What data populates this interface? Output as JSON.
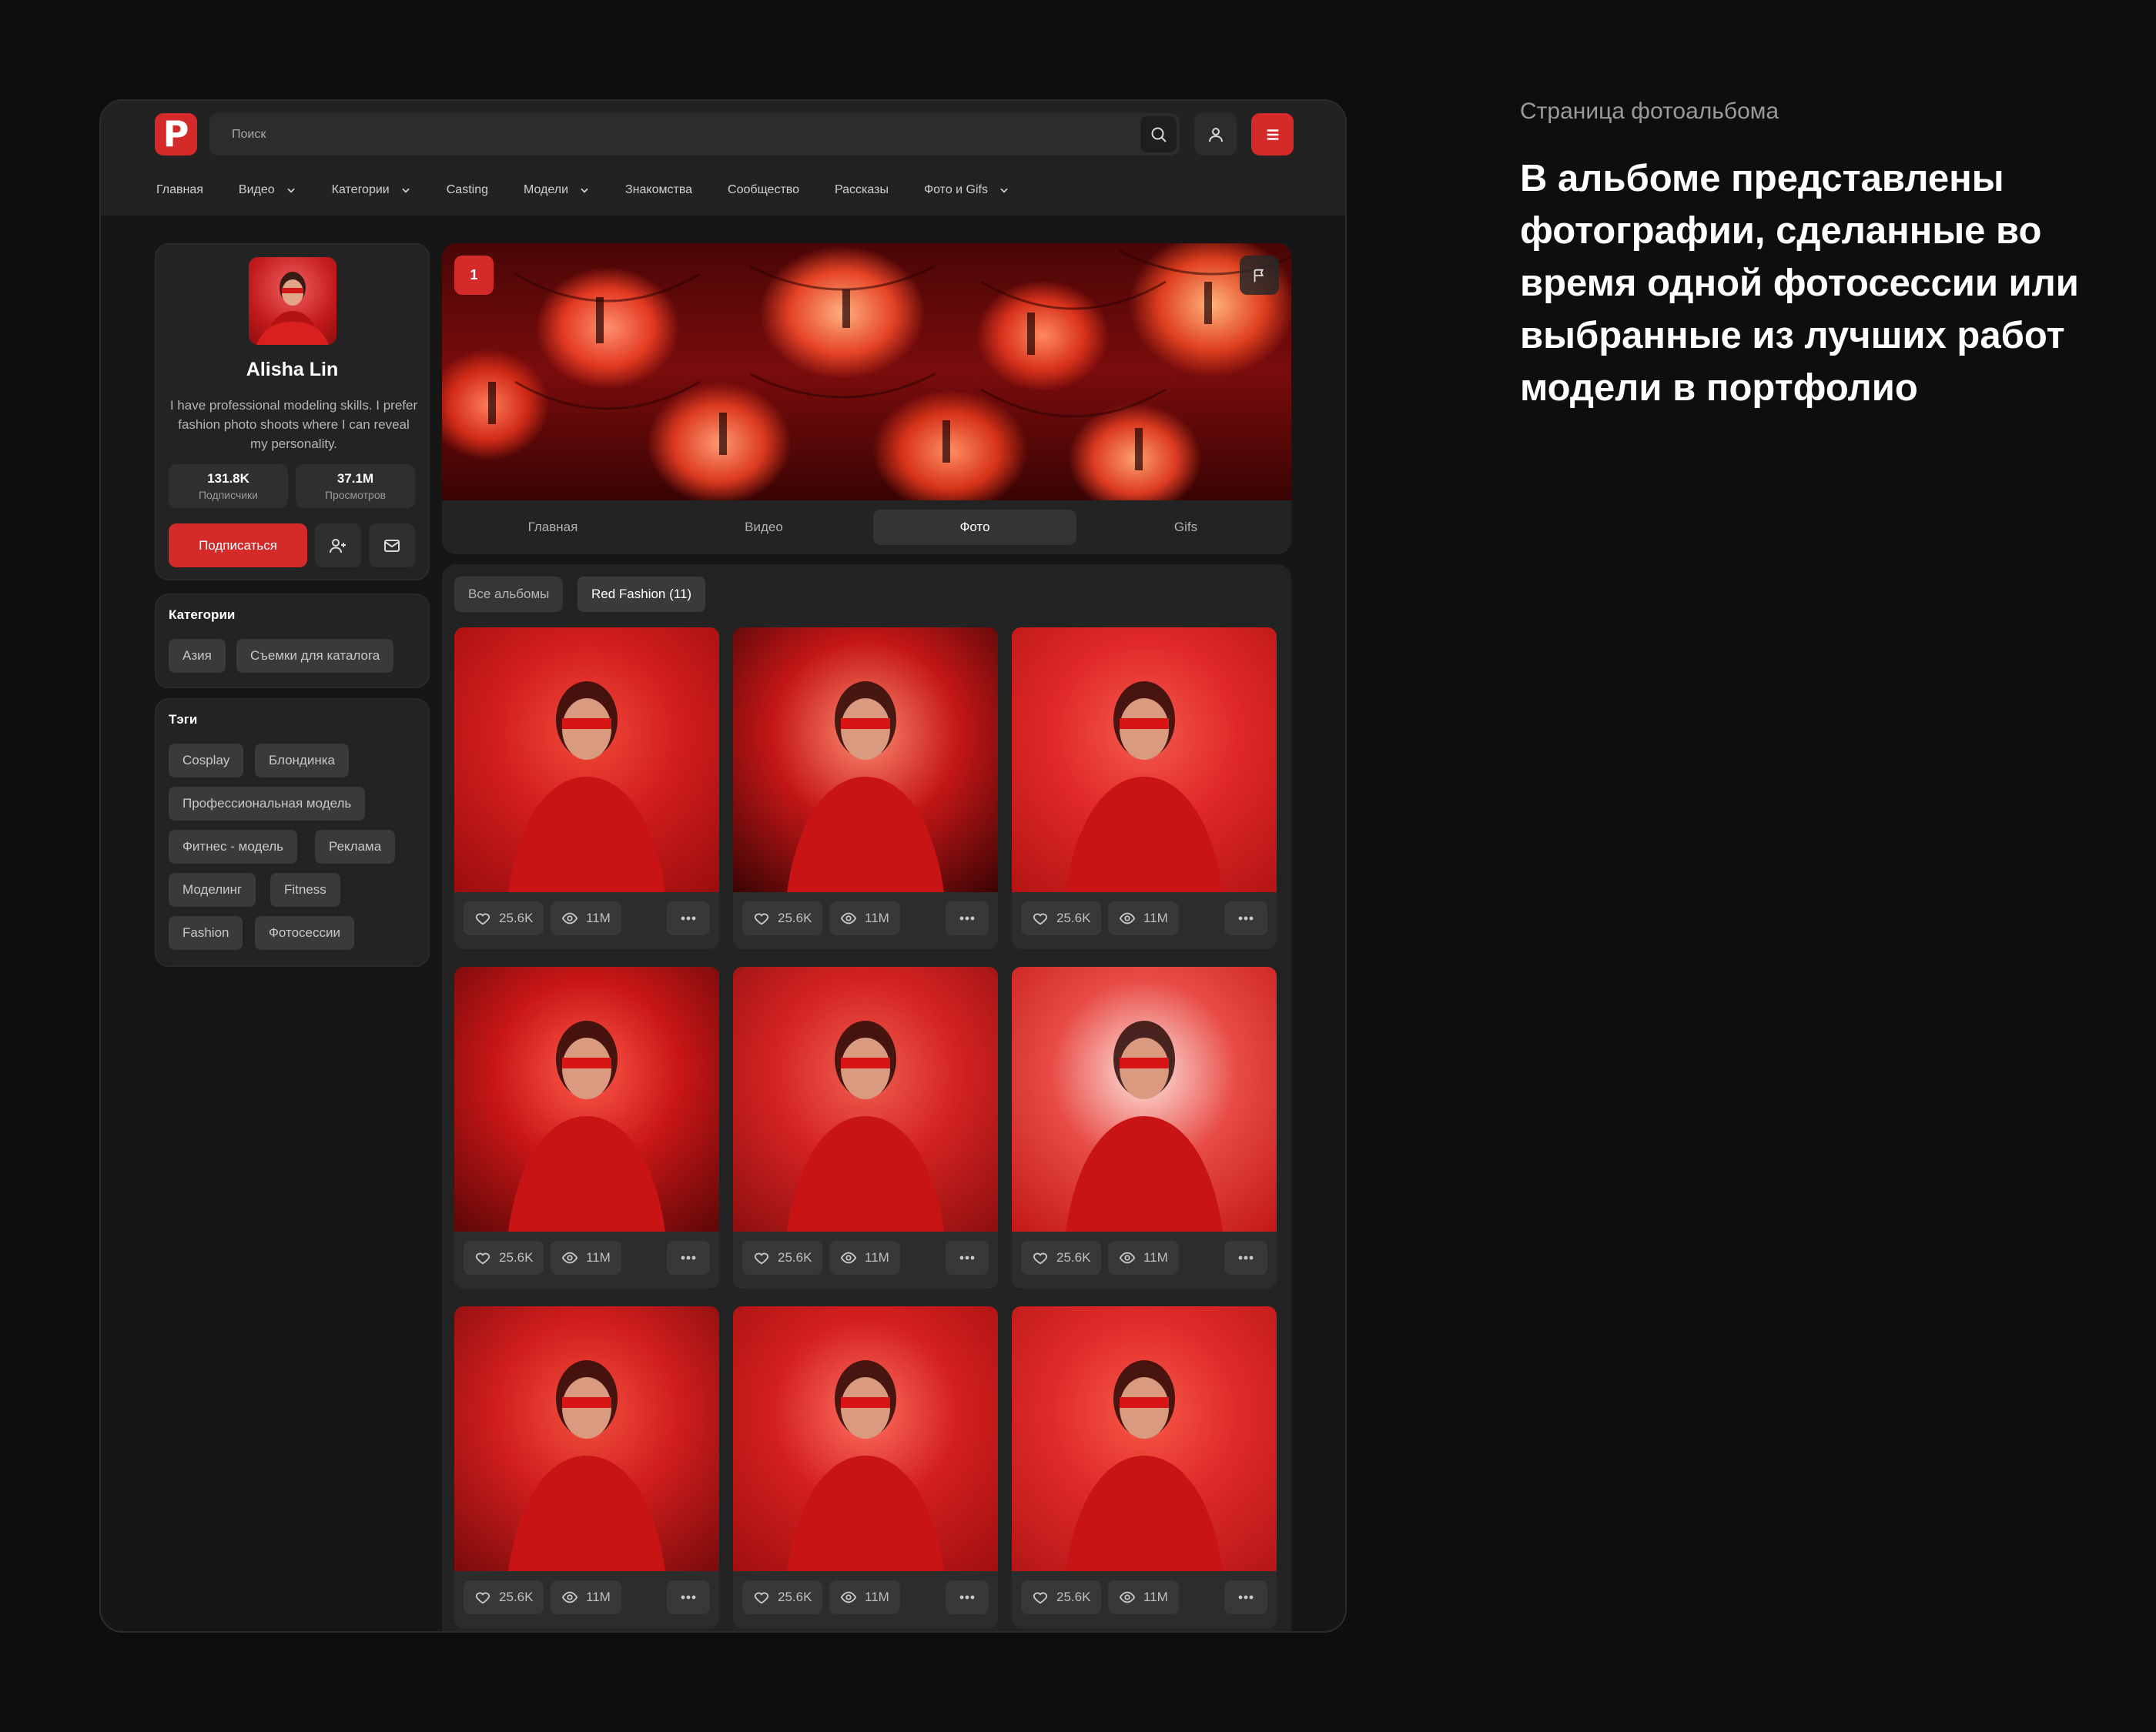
{
  "app": {
    "logo_letter": "P",
    "brand_color": "#d42a2a",
    "search": {
      "placeholder": "Поиск"
    },
    "nav": [
      {
        "label": "Главная",
        "has_dropdown": false
      },
      {
        "label": "Видео",
        "has_dropdown": true
      },
      {
        "label": "Категории",
        "has_dropdown": true
      },
      {
        "label": "Casting",
        "has_dropdown": false
      },
      {
        "label": "Модели",
        "has_dropdown": true
      },
      {
        "label": "Знакомства",
        "has_dropdown": false
      },
      {
        "label": "Сообщество",
        "has_dropdown": false
      },
      {
        "label": "Рассказы",
        "has_dropdown": false
      },
      {
        "label": "Фото и Gifs",
        "has_dropdown": true
      }
    ],
    "icons": [
      "logo-icon",
      "search-icon",
      "user-icon",
      "menu-icon",
      "chevron-down-icon",
      "flag-icon",
      "add-user-icon",
      "mail-icon",
      "heart-icon",
      "eye-icon",
      "more-icon"
    ]
  },
  "profile": {
    "name": "Alisha Lin",
    "bio": "I have professional modeling skills. I prefer fashion photo shoots where I can reveal my personality.",
    "stats": [
      {
        "value": "131.8K",
        "label": "Подписчики"
      },
      {
        "value": "37.1M",
        "label": "Просмотров"
      }
    ],
    "subscribe_label": "Подписаться"
  },
  "categories": {
    "title": "Категории",
    "items": [
      "Азия",
      "Съемки для каталога"
    ]
  },
  "tags": {
    "title": "Тэги",
    "items": [
      "Cosplay",
      "Блондинка",
      "Профессиональная модель",
      "Фитнес - модель",
      "Реклама",
      "Моделинг",
      "Fitness",
      "Fashion",
      "Фотосессии"
    ]
  },
  "hero": {
    "badge": "1",
    "tabs": [
      {
        "label": "Главная",
        "active": false
      },
      {
        "label": "Видео",
        "active": false
      },
      {
        "label": "Фото",
        "active": true
      },
      {
        "label": "Gifs",
        "active": false
      }
    ]
  },
  "albums": {
    "all_label": "Все альбомы",
    "current_label": "Red Fashion (11)"
  },
  "photos": [
    {
      "likes": "25.6K",
      "views": "11M"
    },
    {
      "likes": "25.6K",
      "views": "11M"
    },
    {
      "likes": "25.6K",
      "views": "11M"
    },
    {
      "likes": "25.6K",
      "views": "11M"
    },
    {
      "likes": "25.6K",
      "views": "11M"
    },
    {
      "likes": "25.6K",
      "views": "11M"
    },
    {
      "likes": "25.6K",
      "views": "11M"
    },
    {
      "likes": "25.6K",
      "views": "11M"
    },
    {
      "likes": "25.6K",
      "views": "11M"
    }
  ],
  "description": {
    "caption": "Страница фотоальбома",
    "heading": "В альбоме представлены фотографии, сделанные во время одной фотосессии или выбранные из лучших работ модели в портфолио"
  }
}
